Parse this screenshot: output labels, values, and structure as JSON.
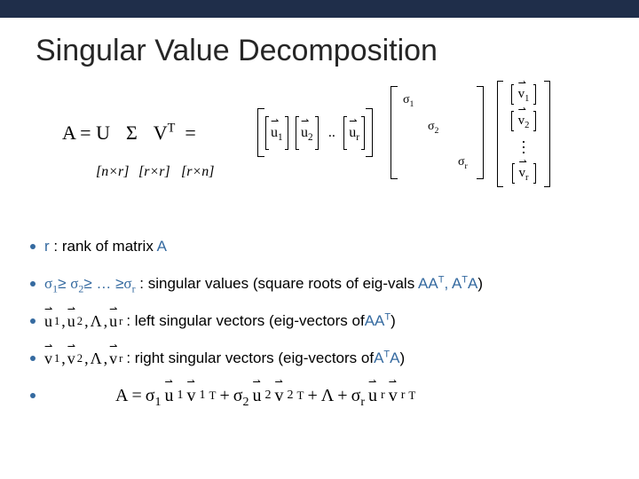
{
  "title": "Singular Value Decomposition",
  "equation": {
    "lhs": "A = U",
    "sigma": "Σ",
    "vt": "V",
    "vt_sup": "T",
    "eq": "=",
    "dims": {
      "d1": "[n×r]",
      "d2": "[r×r]",
      "d3": "[r×n]"
    },
    "ucols": {
      "u1": "u",
      "u1s": "1",
      "u2": "u",
      "u2s": "2",
      "dots": ". .",
      "ur": "u",
      "urs": "r"
    },
    "sigma_diag": {
      "s1": "σ",
      "s1s": "1",
      "s2": "σ",
      "s2s": "2",
      "sr": "σ",
      "srs": "r"
    },
    "vrows": {
      "v1": "v",
      "v1s": "1",
      "v2": "v",
      "v2s": "2",
      "vr": "v",
      "vrs": "r"
    }
  },
  "bullets": {
    "b1": {
      "r": "r",
      "text1": " : rank of matrix ",
      "A": "A"
    },
    "b2": {
      "s1": "σ",
      "s1s": "1",
      "ge1": "≥ ",
      "s2": "σ",
      "s2s": "2",
      "ge2": "≥ … ≥",
      "sr": "σ",
      "srs": "r",
      "text": " : singular values (square roots of eig-vals ",
      "AAT": "AA",
      "supT1": "T",
      "comma": ", ",
      "ATA1": "A",
      "supT2": "T",
      "ATA2": "A",
      "close": ")"
    },
    "b3": {
      "u1": "u",
      "u1s": "1",
      "c1": ",",
      "u2": "u",
      "u2s": "2",
      "c2": ",",
      "lam": "Λ",
      "c3": ",",
      "ur": "u",
      "urs": "r",
      "text": " : left singular vectors (eig-vectors of ",
      "AAT": "AA",
      "supT": "T",
      "close": ")"
    },
    "b4": {
      "v1": "v",
      "v1s": "1",
      "c1": ",",
      "v2": "v",
      "v2s": "2",
      "c2": ",",
      "lam": "Λ",
      "c3": ",",
      "vr": "v",
      "vrs": "r",
      "text": " : right singular vectors (eig-vectors of ",
      "A1": "A",
      "supT": "T",
      "A2": "A",
      "close": ")"
    },
    "b5": {
      "A": "A",
      "eq": " = ",
      "s1": "σ",
      "s1s": "1",
      "u1": "u",
      "u1s": "1",
      "v1": "v",
      "v1s": "1",
      "T1": "T",
      "plus1": " + ",
      "s2": "σ",
      "s2s": "2",
      "u2": "u",
      "u2s": "2",
      "v2": "v",
      "v2s": "2",
      "T2": "T",
      "plus2": " + ",
      "lam": "Λ",
      "plus3": " + ",
      "sr": "σ",
      "srs": "r",
      "ur": "u",
      "urs": "r",
      "vr": "v",
      "vrs": "r",
      "Tr": "T"
    }
  }
}
